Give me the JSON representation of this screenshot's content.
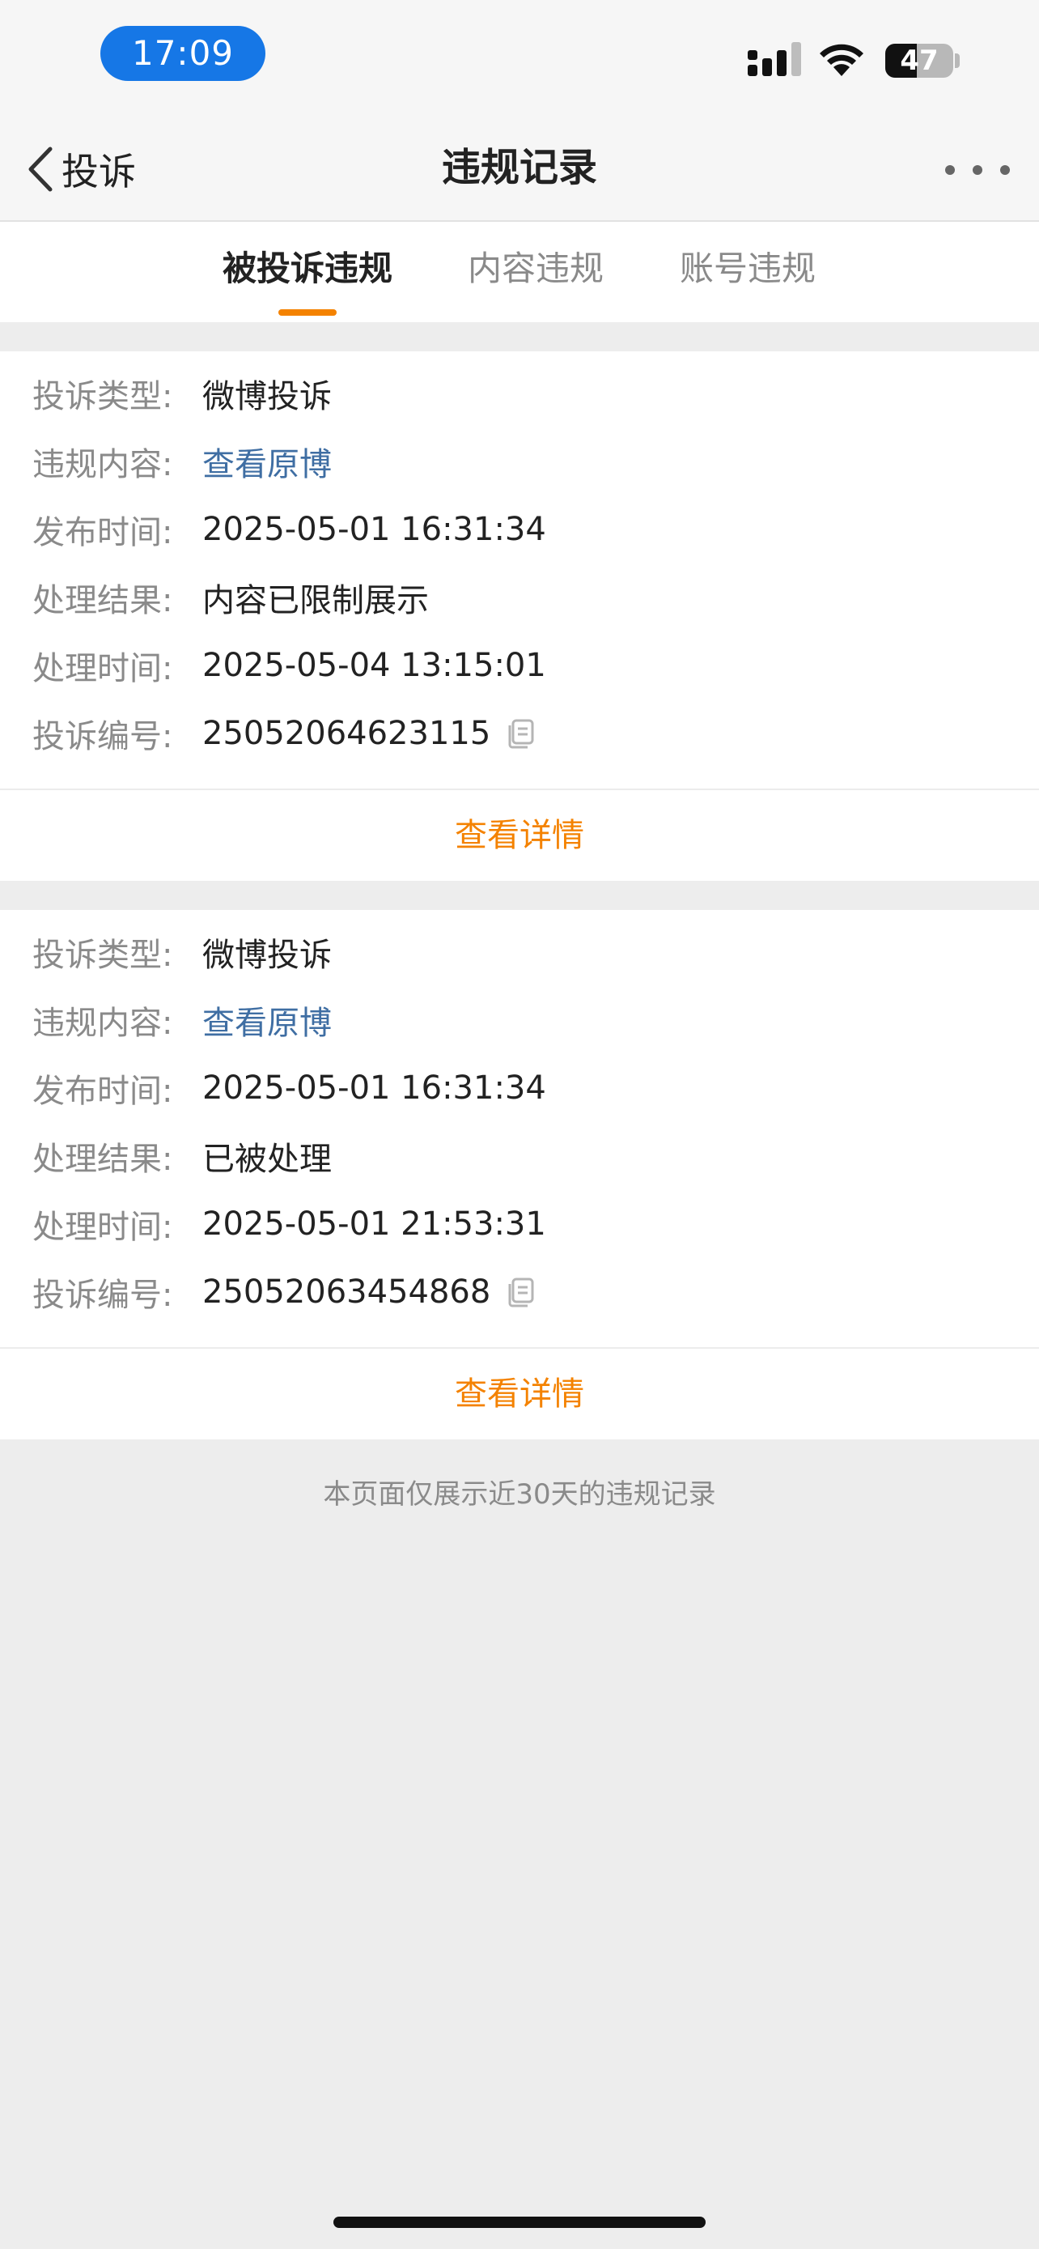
{
  "status_bar": {
    "time": "17:09",
    "battery_level": "47",
    "battery_fraction": 0.47
  },
  "navbar": {
    "back_label": "投诉",
    "title": "违规记录"
  },
  "tabs": [
    {
      "label": "被投诉违规",
      "active": true
    },
    {
      "label": "内容违规",
      "active": false
    },
    {
      "label": "账号违规",
      "active": false
    }
  ],
  "records": [
    {
      "complaint_type_label": "投诉类型:",
      "complaint_type": "微博投诉",
      "content_label": "违规内容:",
      "content_link": "查看原博",
      "publish_time_label": "发布时间:",
      "publish_time": "2025-05-01 16:31:34",
      "result_label": "处理结果:",
      "result": "内容已限制展示",
      "handle_time_label": "处理时间:",
      "handle_time": "2025-05-04 13:15:01",
      "complaint_id_label": "投诉编号:",
      "complaint_id": "25052064623115",
      "detail_button": "查看详情"
    },
    {
      "complaint_type_label": "投诉类型:",
      "complaint_type": "微博投诉",
      "content_label": "违规内容:",
      "content_link": "查看原博",
      "publish_time_label": "发布时间:",
      "publish_time": "2025-05-01 16:31:34",
      "result_label": "处理结果:",
      "result": "已被处理",
      "handle_time_label": "处理时间:",
      "handle_time": "2025-05-01 21:53:31",
      "complaint_id_label": "投诉编号:",
      "complaint_id": "25052063454868",
      "detail_button": "查看详情"
    }
  ],
  "footer_note": "本页面仅展示近30天的违规记录",
  "colors": {
    "accent": "#f48200",
    "link": "#3f6ea3",
    "time_pill": "#1677e6"
  },
  "icons": {
    "back": "chevron-left-icon",
    "more": "more-dots-icon",
    "copy": "copy-icon",
    "signal": "cellular-signal-icon",
    "wifi": "wifi-icon"
  }
}
